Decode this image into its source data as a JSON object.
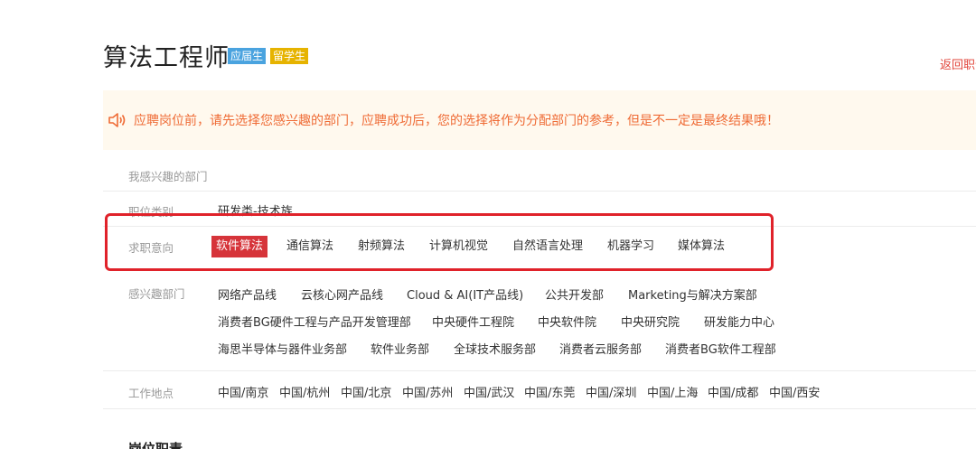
{
  "header": {
    "title": "算法工程师",
    "tags": [
      "应届生",
      "留学生"
    ],
    "back_link": "返回职位"
  },
  "notice": {
    "icon": "speaker-icon",
    "text": "应聘岗位前，请先选择您感兴趣的部门，应聘成功后，您的选择将作为分配部门的参考，但是不一定是最终结果哦！"
  },
  "form": {
    "interested_dept_heading": "我感兴趣的部门",
    "category": {
      "label": "职位类别",
      "value": "研发类-技术族"
    },
    "intent": {
      "label": "求职意向",
      "options": [
        "软件算法",
        "通信算法",
        "射频算法",
        "计算机视觉",
        "自然语言处理",
        "机器学习",
        "媒体算法"
      ],
      "selected": "软件算法"
    },
    "departments": {
      "label": "感兴趣部门",
      "rows": [
        [
          "网络产品线",
          "云核心网产品线",
          "Cloud & AI(IT产品线)",
          "公共开发部",
          "Marketing与解决方案部"
        ],
        [
          "消费者BG硬件工程与产品开发管理部",
          "中央硬件工程院",
          "中央软件院",
          "中央研究院",
          "研发能力中心"
        ],
        [
          "海思半导体与器件业务部",
          "软件业务部",
          "全球技术服务部",
          "消费者云服务部",
          "消费者BG软件工程部"
        ]
      ]
    },
    "location": {
      "label": "工作地点",
      "options": [
        "中国/南京",
        "中国/杭州",
        "中国/北京",
        "中国/苏州",
        "中国/武汉",
        "中国/东莞",
        "中国/深圳",
        "中国/上海",
        "中国/成都",
        "中国/西安"
      ]
    }
  },
  "next_section": "岗位职责",
  "colors": {
    "accent_red": "#d6343a",
    "notice_bg": "#fff9ee",
    "notice_text": "#ef6b35",
    "tag_blue": "#4aa3df",
    "tag_yellow": "#e6b300"
  }
}
